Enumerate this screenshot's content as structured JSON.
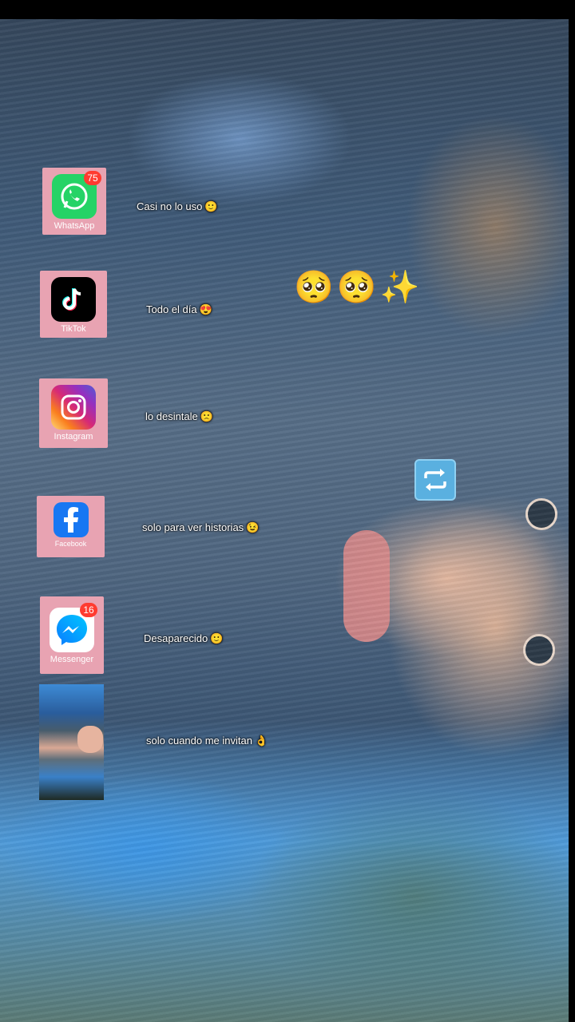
{
  "apps": [
    {
      "name": "WhatsApp",
      "badge": "75",
      "caption": "Casi no lo uso",
      "caption_emoji": "🙂",
      "color": "#25d366",
      "icon": "whatsapp-icon"
    },
    {
      "name": "TikTok",
      "badge": "",
      "caption": "Todo el día",
      "caption_emoji": "😍",
      "color": "#000000",
      "icon": "tiktok-icon"
    },
    {
      "name": "Instagram",
      "badge": "",
      "caption": "lo desintale",
      "caption_emoji": "🙁",
      "color": "#e1306c",
      "icon": "instagram-icon"
    },
    {
      "name": "Facebook",
      "badge": "",
      "caption": "solo para ver historias",
      "caption_emoji": "😉",
      "color": "#1877f2",
      "icon": "facebook-icon"
    },
    {
      "name": "Messenger",
      "badge": "16",
      "caption": "Desaparecido",
      "caption_emoji": "🙂",
      "color": "#0a7cff",
      "icon": "messenger-icon"
    }
  ],
  "last_row": {
    "caption": "solo cuando me invitan",
    "caption_emoji": "👌"
  },
  "overlay": {
    "big_emojis": "🥺🥺✨",
    "repeat_icon": "repeat-arrows-icon"
  }
}
